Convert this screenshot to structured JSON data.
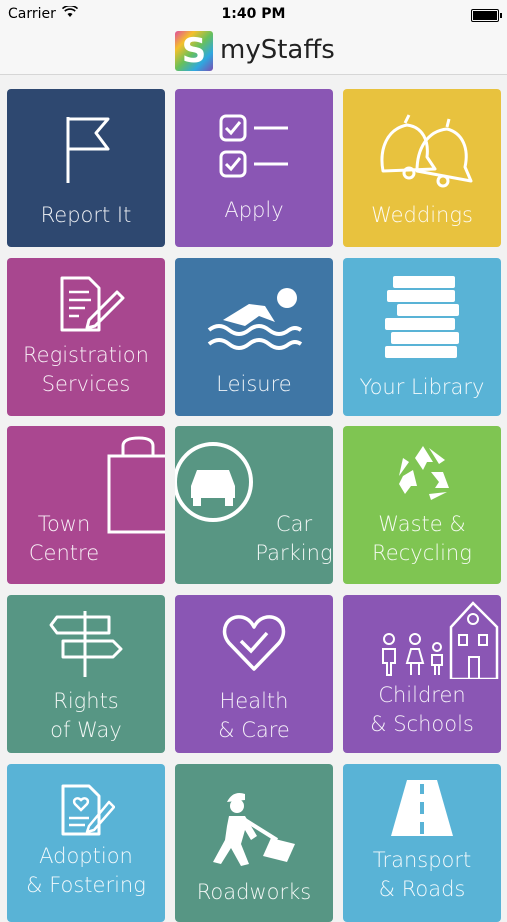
{
  "status_bar": {
    "carrier": "Carrier",
    "time": "1:40 PM"
  },
  "header": {
    "logo_letter": "S",
    "title": "myStaffs"
  },
  "tiles": [
    {
      "label": "Report It",
      "color": "#2e4870",
      "icon": "flag-icon"
    },
    {
      "label": "Apply",
      "color": "#8a56b4",
      "icon": "checklist-icon"
    },
    {
      "label": "Weddings",
      "color": "#e8c23e",
      "icon": "bells-icon"
    },
    {
      "label": "Registration\nServices",
      "color": "#a8478f",
      "icon": "document-pen-icon"
    },
    {
      "label": "Leisure",
      "color": "#3f76a5",
      "icon": "swimmer-icon"
    },
    {
      "label": "Your Library",
      "color": "#59b3d6",
      "icon": "books-icon"
    },
    {
      "label": "Town\nCentre",
      "color": "#aa4790",
      "icon": "shopping-bag-icon"
    },
    {
      "label": "Car\nParking",
      "color": "#589683",
      "icon": "car-icon"
    },
    {
      "label": "Waste &\nRecycling",
      "color": "#7fc552",
      "icon": "recycle-icon"
    },
    {
      "label": "Rights\nof Way",
      "color": "#579684",
      "icon": "signpost-icon"
    },
    {
      "label": "Health\n& Care",
      "color": "#8a56b4",
      "icon": "heart-check-icon"
    },
    {
      "label": "Children\n& Schools",
      "color": "#8a56b4",
      "icon": "school-children-icon"
    },
    {
      "label": "Adoption\n& Fostering",
      "color": "#59b3d6",
      "icon": "document-heart-icon"
    },
    {
      "label": "Roadworks",
      "color": "#579684",
      "icon": "worker-shovel-icon"
    },
    {
      "label": "Transport\n& Roads",
      "color": "#59b3d6",
      "icon": "road-icon"
    }
  ]
}
